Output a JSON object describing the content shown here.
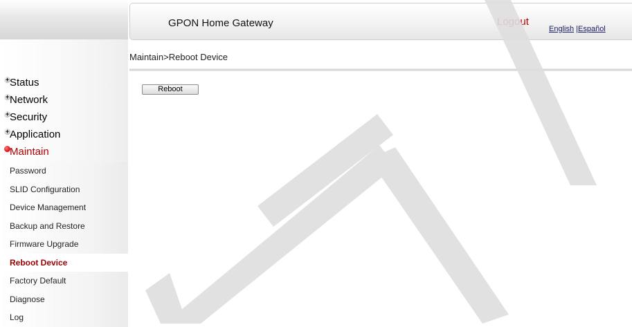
{
  "header": {
    "title": "GPON Home Gateway",
    "logout_label": "Logout",
    "lang_english": "English",
    "lang_separator": " |",
    "lang_spanish": "Español"
  },
  "breadcrumb": "Maintain>Reboot Device",
  "main": {
    "reboot_button_label": "Reboot"
  },
  "sidebar": {
    "menu": [
      {
        "label": "Status",
        "icon": "plus-icon"
      },
      {
        "label": "Network",
        "icon": "plus-icon"
      },
      {
        "label": "Security",
        "icon": "plus-icon"
      },
      {
        "label": "Application",
        "icon": "plus-icon"
      },
      {
        "label": "Maintain",
        "icon": "minus-icon",
        "active": true
      }
    ],
    "submenu": [
      {
        "label": "Password"
      },
      {
        "label": "SLID Configuration"
      },
      {
        "label": "Device Management"
      },
      {
        "label": "Backup and Restore"
      },
      {
        "label": "Firmware Upgrade"
      },
      {
        "label": "Reboot Device",
        "active": true
      },
      {
        "label": "Factory Default"
      },
      {
        "label": "Diagnose"
      },
      {
        "label": "Log"
      }
    ]
  },
  "colors": {
    "accent_red": "#c00000",
    "active_submenu": "#9b0000",
    "watermark_gray": "#dddddd"
  }
}
